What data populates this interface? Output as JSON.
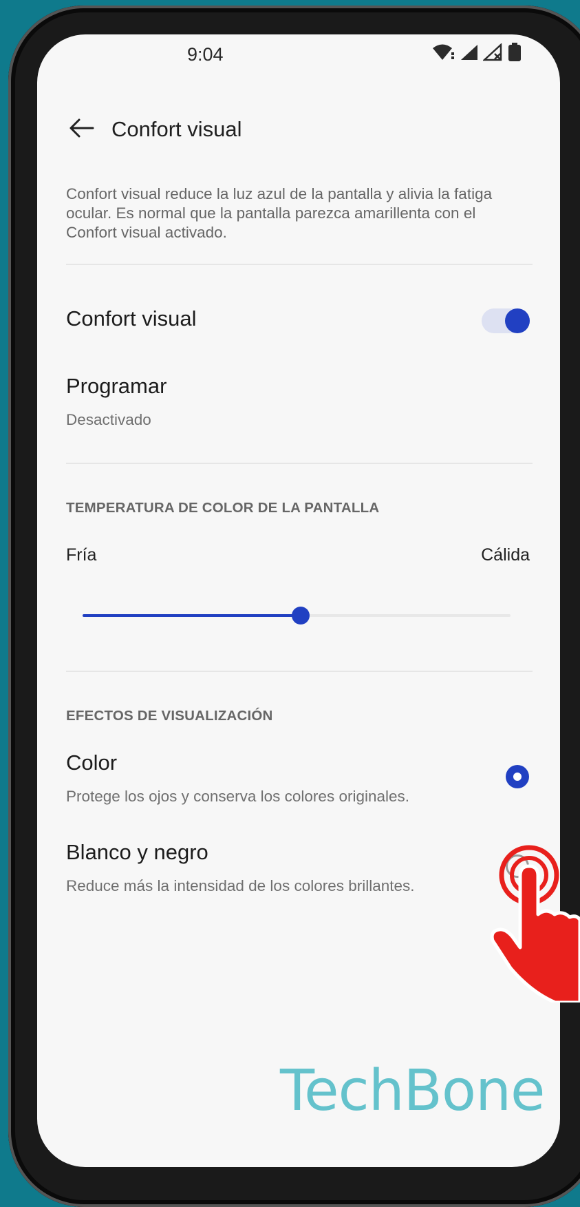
{
  "status_bar": {
    "time": "9:04",
    "icons": [
      "wifi-icon",
      "signal-icon",
      "signal-no-service-icon",
      "battery-icon"
    ]
  },
  "header": {
    "back_icon": "arrow-left-icon",
    "title": "Confort visual"
  },
  "description": "Confort visual reduce la luz azul de la pantalla y alivia la fatiga ocular. Es normal que la pantalla parezca amarillenta con el Confort visual activado.",
  "settings": {
    "confort_visual": {
      "label": "Confort visual",
      "enabled": true
    },
    "programar": {
      "label": "Programar",
      "value": "Desactivado"
    }
  },
  "temperature": {
    "section_title": "TEMPERATURA DE COLOR DE LA PANTALLA",
    "min_label": "Fría",
    "max_label": "Cálida",
    "value_fraction": 0.51
  },
  "effects": {
    "section_title": "EFECTOS DE VISUALIZACIÓN",
    "options": [
      {
        "title": "Color",
        "subtitle": "Protege los ojos y conserva los colores originales.",
        "selected": true
      },
      {
        "title": "Blanco y negro",
        "subtitle": "Reduce más la intensidad de los colores brillantes.",
        "selected": false
      }
    ]
  },
  "watermark": "TechBone",
  "colors": {
    "accent": "#2140c2",
    "background": "#0f7a8c",
    "screen": "#f7f7f7",
    "pointer": "#e8201c"
  }
}
